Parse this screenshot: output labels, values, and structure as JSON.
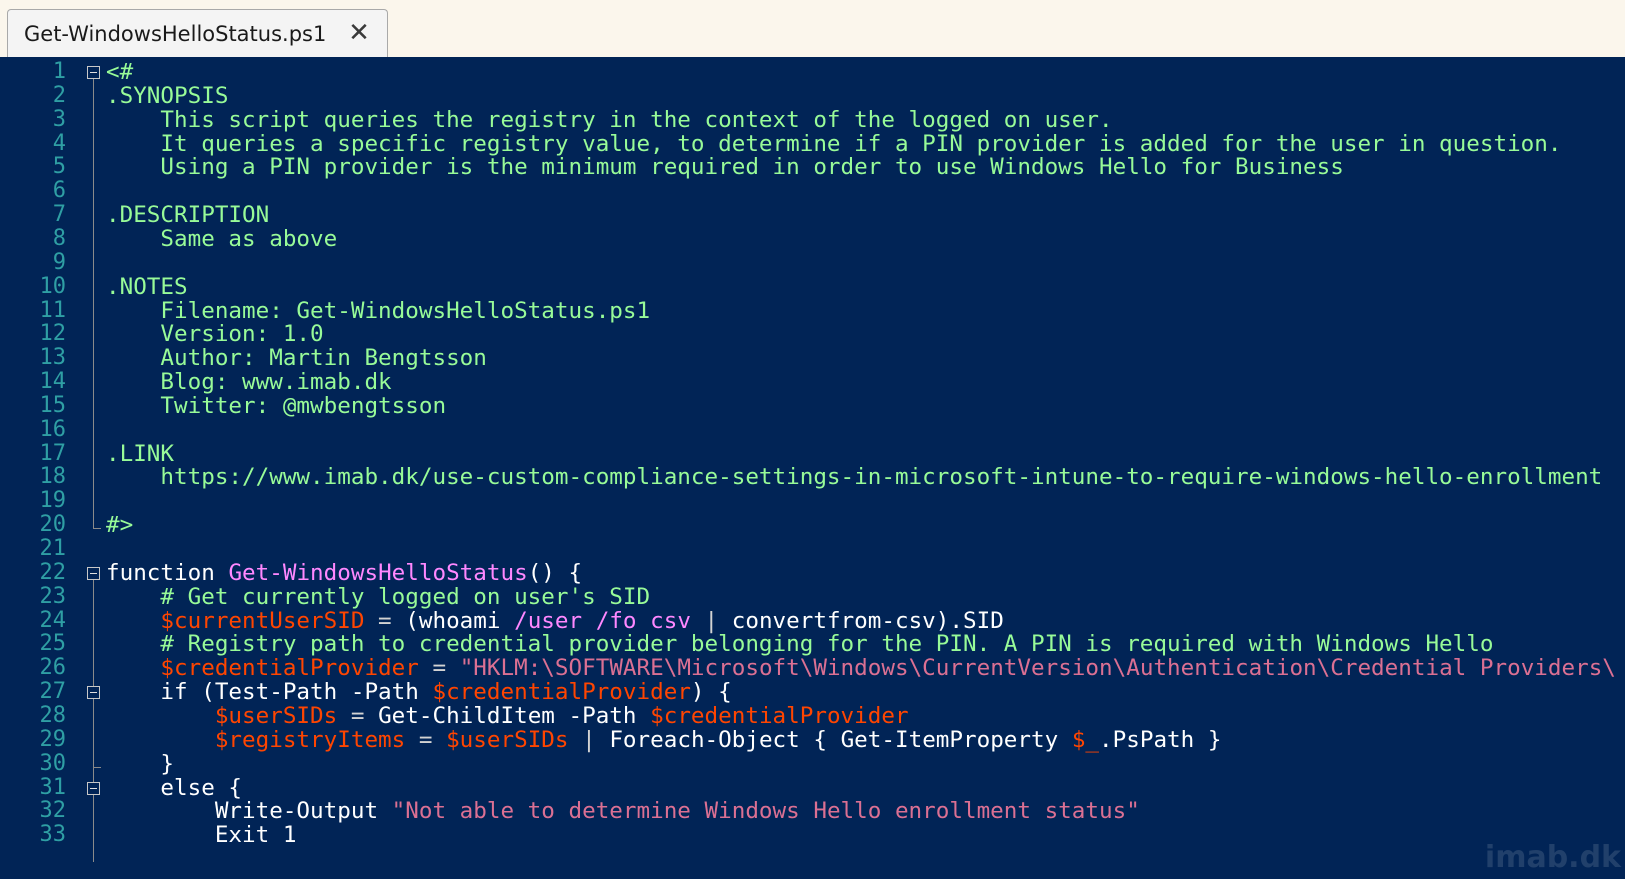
{
  "tab": {
    "title": "Get-WindowsHelloStatus.ps1",
    "close_glyph": "✕"
  },
  "colors": {
    "editor_bg": "#012456",
    "comment": "#98fb98",
    "variable": "#ff4500",
    "string": "#db7093",
    "function_name": "#ff88ff",
    "line_number": "#2f9fa4"
  },
  "watermark": "imab.dk",
  "lines": [
    {
      "n": "1",
      "tokens": [
        [
          "com",
          "<#"
        ]
      ]
    },
    {
      "n": "2",
      "tokens": [
        [
          "com",
          ".SYNOPSIS"
        ]
      ]
    },
    {
      "n": "3",
      "tokens": [
        [
          "com",
          "    This script queries the registry in the context of the logged on user."
        ]
      ]
    },
    {
      "n": "4",
      "tokens": [
        [
          "com",
          "    It queries a specific registry value, to determine if a PIN provider is added for the user in question."
        ]
      ]
    },
    {
      "n": "5",
      "tokens": [
        [
          "com",
          "    Using a PIN provider is the minimum required in order to use Windows Hello for Business"
        ]
      ]
    },
    {
      "n": "6",
      "tokens": []
    },
    {
      "n": "7",
      "tokens": [
        [
          "com",
          ".DESCRIPTION"
        ]
      ]
    },
    {
      "n": "8",
      "tokens": [
        [
          "com",
          "    Same as above"
        ]
      ]
    },
    {
      "n": "9",
      "tokens": []
    },
    {
      "n": "10",
      "tokens": [
        [
          "com",
          ".NOTES"
        ]
      ]
    },
    {
      "n": "11",
      "tokens": [
        [
          "com",
          "    Filename: Get-WindowsHelloStatus.ps1"
        ]
      ]
    },
    {
      "n": "12",
      "tokens": [
        [
          "com",
          "    Version: 1.0"
        ]
      ]
    },
    {
      "n": "13",
      "tokens": [
        [
          "com",
          "    Author: Martin Bengtsson"
        ]
      ]
    },
    {
      "n": "14",
      "tokens": [
        [
          "com",
          "    Blog: www.imab.dk"
        ]
      ]
    },
    {
      "n": "15",
      "tokens": [
        [
          "com",
          "    Twitter: @mwbengtsson"
        ]
      ]
    },
    {
      "n": "16",
      "tokens": []
    },
    {
      "n": "17",
      "tokens": [
        [
          "com",
          ".LINK"
        ]
      ]
    },
    {
      "n": "18",
      "tokens": [
        [
          "com",
          "    https://www.imab.dk/use-custom-compliance-settings-in-microsoft-intune-to-require-windows-hello-enrollment"
        ]
      ]
    },
    {
      "n": "19",
      "tokens": []
    },
    {
      "n": "20",
      "tokens": [
        [
          "com",
          "#>"
        ]
      ]
    },
    {
      "n": "21",
      "tokens": []
    },
    {
      "n": "22",
      "tokens": [
        [
          "key",
          "function "
        ],
        [
          "fn",
          "Get-WindowsHelloStatus"
        ],
        [
          "key",
          "() {"
        ]
      ]
    },
    {
      "n": "23",
      "tokens": [
        [
          "com",
          "    # Get currently logged on user's SID"
        ]
      ]
    },
    {
      "n": "24",
      "tokens": [
        [
          "var",
          "    $currentUserSID"
        ],
        [
          "op",
          " = "
        ],
        [
          "key",
          "(whoami "
        ],
        [
          "pth",
          "/user /fo csv"
        ],
        [
          "op",
          " | "
        ],
        [
          "key",
          "convertfrom-csv).SID"
        ]
      ]
    },
    {
      "n": "25",
      "tokens": [
        [
          "com",
          "    # Registry path to credential provider belonging for the PIN. A PIN is required with Windows Hello"
        ]
      ]
    },
    {
      "n": "26",
      "tokens": [
        [
          "var",
          "    $credentialProvider"
        ],
        [
          "op",
          " = "
        ],
        [
          "str",
          "\"HKLM:\\SOFTWARE\\Microsoft\\Windows\\CurrentVersion\\Authentication\\Credential Providers\\"
        ]
      ]
    },
    {
      "n": "27",
      "tokens": [
        [
          "key",
          "    if (Test-Path -Path "
        ],
        [
          "var",
          "$credentialProvider"
        ],
        [
          "key",
          ") {"
        ]
      ]
    },
    {
      "n": "28",
      "tokens": [
        [
          "var",
          "        $userSIDs"
        ],
        [
          "op",
          " = "
        ],
        [
          "key",
          "Get-ChildItem -Path "
        ],
        [
          "var",
          "$credentialProvider"
        ]
      ]
    },
    {
      "n": "29",
      "tokens": [
        [
          "var",
          "        $registryItems"
        ],
        [
          "op",
          " = "
        ],
        [
          "var",
          "$userSIDs"
        ],
        [
          "op",
          " | "
        ],
        [
          "key",
          "Foreach-Object { Get-ItemProperty "
        ],
        [
          "var",
          "$_"
        ],
        [
          "key",
          ".PsPath }"
        ]
      ]
    },
    {
      "n": "30",
      "tokens": [
        [
          "key",
          "    }"
        ]
      ]
    },
    {
      "n": "31",
      "tokens": [
        [
          "key",
          "    else {"
        ]
      ]
    },
    {
      "n": "32",
      "tokens": [
        [
          "key",
          "        Write-Output "
        ],
        [
          "str",
          "\"Not able to determine Windows Hello enrollment status\""
        ]
      ]
    },
    {
      "n": "33",
      "tokens": [
        [
          "key",
          "        Exit 1"
        ]
      ]
    }
  ]
}
